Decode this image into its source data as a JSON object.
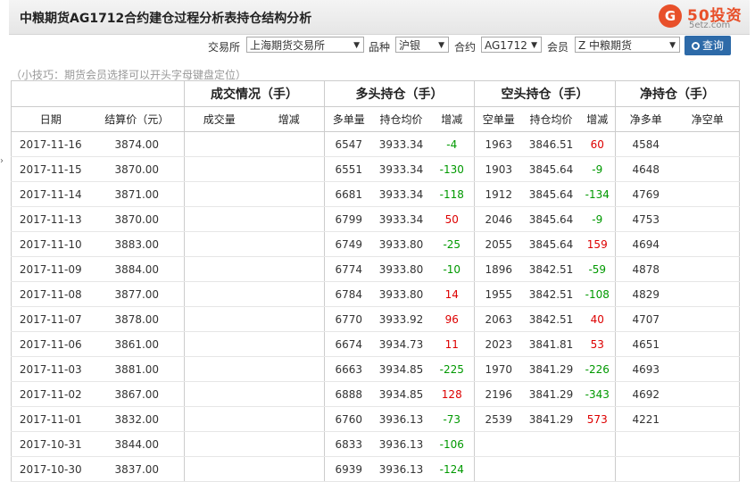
{
  "header": {
    "title": "中粮期货AG1712合约建仓过程分析表持仓结构分析"
  },
  "logo": {
    "brand": "50投资",
    "domain": "5etz.com",
    "mark": "G"
  },
  "filters": {
    "exchange_label": "交易所",
    "exchange_value": "上海期货交易所",
    "variety_label": "品种",
    "variety_value": "沪银",
    "contract_label": "合约",
    "contract_value": "AG1712",
    "member_label": "会员",
    "member_value": "Z 中粮期货",
    "query_label": "查询"
  },
  "tip": "（小技巧：期货会员选择可以开头字母键盘定位）",
  "table": {
    "groups": [
      "成交情况（手）",
      "多头持仓（手）",
      "空头持仓（手）",
      "净持仓（手）"
    ],
    "columns": [
      "日期",
      "结算价（元）",
      "成交量",
      "增减",
      "多单量",
      "持仓均价",
      "增减",
      "空单量",
      "持仓均价",
      "增减",
      "净多单",
      "净空单"
    ],
    "rows": [
      {
        "date": "2017-11-16",
        "settle": "3874.00",
        "vol": "",
        "vol_chg": "",
        "long": "6547",
        "long_avg": "3933.34",
        "long_chg": "-4",
        "short": "1963",
        "short_avg": "3846.51",
        "short_chg": "60",
        "net_long": "4584",
        "net_short": ""
      },
      {
        "date": "2017-11-15",
        "settle": "3870.00",
        "vol": "",
        "vol_chg": "",
        "long": "6551",
        "long_avg": "3933.34",
        "long_chg": "-130",
        "short": "1903",
        "short_avg": "3845.64",
        "short_chg": "-9",
        "net_long": "4648",
        "net_short": ""
      },
      {
        "date": "2017-11-14",
        "settle": "3871.00",
        "vol": "",
        "vol_chg": "",
        "long": "6681",
        "long_avg": "3933.34",
        "long_chg": "-118",
        "short": "1912",
        "short_avg": "3845.64",
        "short_chg": "-134",
        "net_long": "4769",
        "net_short": ""
      },
      {
        "date": "2017-11-13",
        "settle": "3870.00",
        "vol": "",
        "vol_chg": "",
        "long": "6799",
        "long_avg": "3933.34",
        "long_chg": "50",
        "short": "2046",
        "short_avg": "3845.64",
        "short_chg": "-9",
        "net_long": "4753",
        "net_short": ""
      },
      {
        "date": "2017-11-10",
        "settle": "3883.00",
        "vol": "",
        "vol_chg": "",
        "long": "6749",
        "long_avg": "3933.80",
        "long_chg": "-25",
        "short": "2055",
        "short_avg": "3845.64",
        "short_chg": "159",
        "net_long": "4694",
        "net_short": ""
      },
      {
        "date": "2017-11-09",
        "settle": "3884.00",
        "vol": "",
        "vol_chg": "",
        "long": "6774",
        "long_avg": "3933.80",
        "long_chg": "-10",
        "short": "1896",
        "short_avg": "3842.51",
        "short_chg": "-59",
        "net_long": "4878",
        "net_short": ""
      },
      {
        "date": "2017-11-08",
        "settle": "3877.00",
        "vol": "",
        "vol_chg": "",
        "long": "6784",
        "long_avg": "3933.80",
        "long_chg": "14",
        "short": "1955",
        "short_avg": "3842.51",
        "short_chg": "-108",
        "net_long": "4829",
        "net_short": ""
      },
      {
        "date": "2017-11-07",
        "settle": "3878.00",
        "vol": "",
        "vol_chg": "",
        "long": "6770",
        "long_avg": "3933.92",
        "long_chg": "96",
        "short": "2063",
        "short_avg": "3842.51",
        "short_chg": "40",
        "net_long": "4707",
        "net_short": ""
      },
      {
        "date": "2017-11-06",
        "settle": "3861.00",
        "vol": "",
        "vol_chg": "",
        "long": "6674",
        "long_avg": "3934.73",
        "long_chg": "11",
        "short": "2023",
        "short_avg": "3841.81",
        "short_chg": "53",
        "net_long": "4651",
        "net_short": ""
      },
      {
        "date": "2017-11-03",
        "settle": "3881.00",
        "vol": "",
        "vol_chg": "",
        "long": "6663",
        "long_avg": "3934.85",
        "long_chg": "-225",
        "short": "1970",
        "short_avg": "3841.29",
        "short_chg": "-226",
        "net_long": "4693",
        "net_short": ""
      },
      {
        "date": "2017-11-02",
        "settle": "3867.00",
        "vol": "",
        "vol_chg": "",
        "long": "6888",
        "long_avg": "3934.85",
        "long_chg": "128",
        "short": "2196",
        "short_avg": "3841.29",
        "short_chg": "-343",
        "net_long": "4692",
        "net_short": ""
      },
      {
        "date": "2017-11-01",
        "settle": "3832.00",
        "vol": "",
        "vol_chg": "",
        "long": "6760",
        "long_avg": "3936.13",
        "long_chg": "-73",
        "short": "2539",
        "short_avg": "3841.29",
        "short_chg": "573",
        "net_long": "4221",
        "net_short": ""
      },
      {
        "date": "2017-10-31",
        "settle": "3844.00",
        "vol": "",
        "vol_chg": "",
        "long": "6833",
        "long_avg": "3936.13",
        "long_chg": "-106",
        "short": "",
        "short_avg": "",
        "short_chg": "",
        "net_long": "",
        "net_short": ""
      },
      {
        "date": "2017-10-30",
        "settle": "3837.00",
        "vol": "",
        "vol_chg": "",
        "long": "6939",
        "long_avg": "3936.13",
        "long_chg": "-124",
        "short": "",
        "short_avg": "",
        "short_chg": "",
        "net_long": "",
        "net_short": ""
      }
    ]
  },
  "colors": {
    "positive": "#dd0000",
    "negative": "#009900",
    "button": "#2d6aa8",
    "brand": "#e8502a"
  }
}
